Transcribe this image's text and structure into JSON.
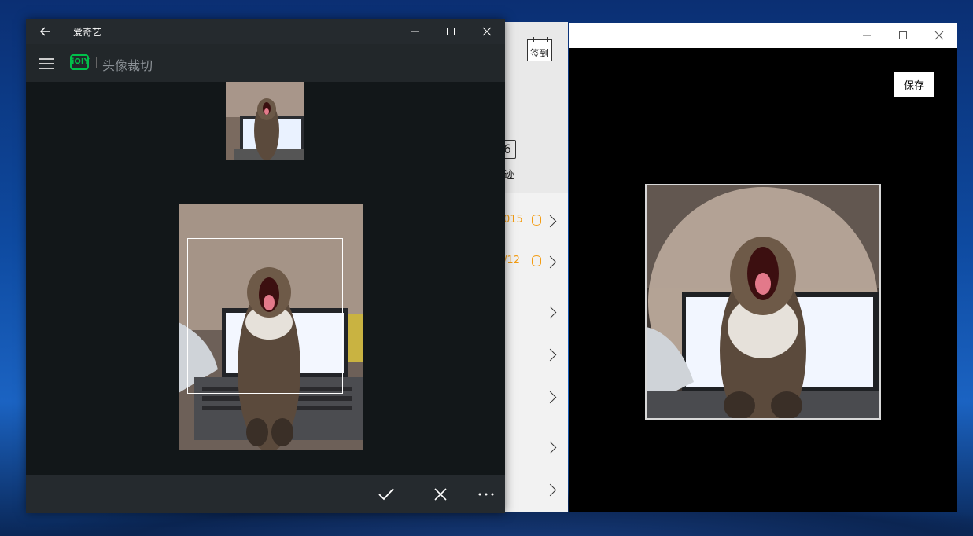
{
  "iqiyi_window": {
    "title": "爱奇艺",
    "header_title": "头像裁切",
    "logo_text": "iQIY",
    "accent_color": "#00c04a",
    "bottom_bar": {
      "confirm_icon": "check-icon",
      "cancel_icon": "close-icon",
      "more_icon": "more-icon"
    }
  },
  "middle_app": {
    "checkin_label": "签到",
    "calendar_number": "6",
    "trace_label": "迹",
    "rows": [
      {
        "value": "015"
      },
      {
        "value": "/12"
      }
    ],
    "accent_color": "#f39c12"
  },
  "preview_window": {
    "save_label": "保存"
  }
}
